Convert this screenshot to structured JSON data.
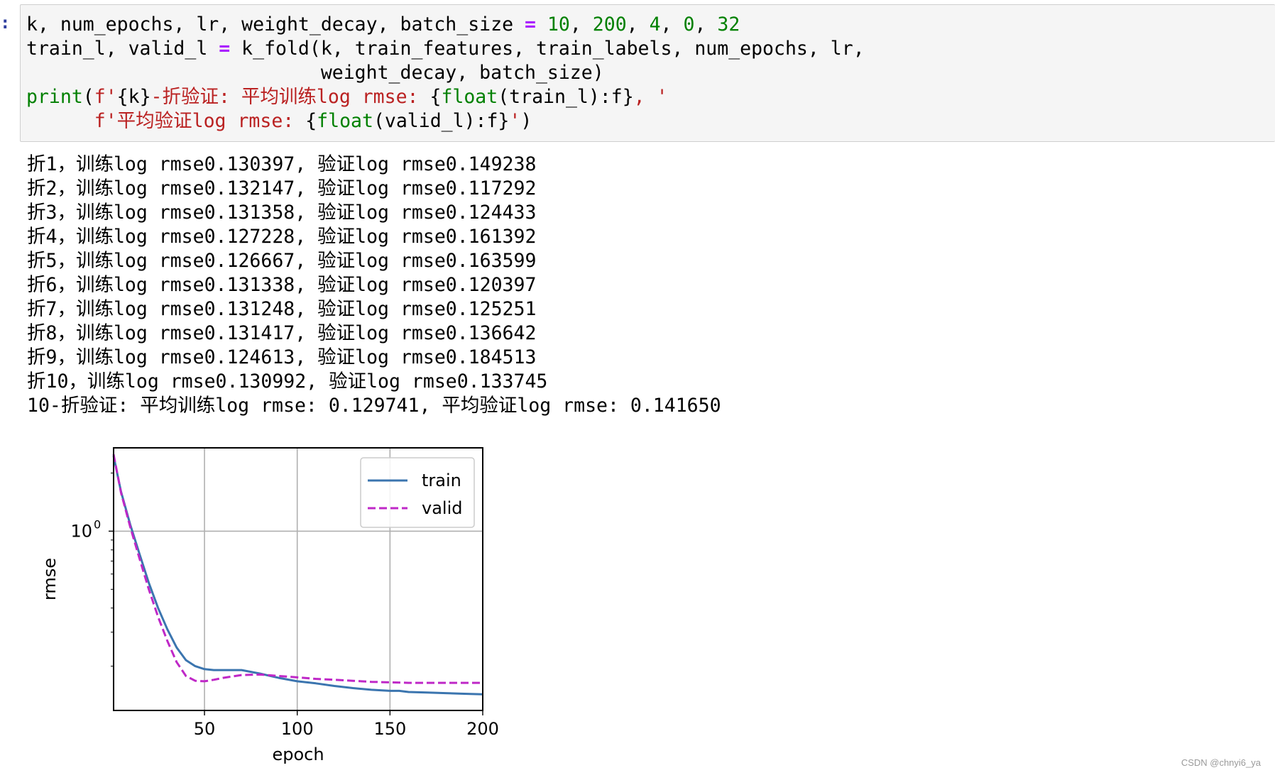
{
  "cell": {
    "prompt": ":",
    "code": [
      [
        {
          "t": "k, num_epochs, lr, weight_decay, batch_size ",
          "c": ""
        },
        {
          "t": "=",
          "c": "op"
        },
        {
          "t": " ",
          "c": ""
        },
        {
          "t": "10",
          "c": "num"
        },
        {
          "t": ", ",
          "c": ""
        },
        {
          "t": "200",
          "c": "num"
        },
        {
          "t": ", ",
          "c": ""
        },
        {
          "t": "4",
          "c": "num"
        },
        {
          "t": ", ",
          "c": ""
        },
        {
          "t": "0",
          "c": "num"
        },
        {
          "t": ", ",
          "c": ""
        },
        {
          "t": "32",
          "c": "num"
        }
      ],
      [
        {
          "t": "train_l, valid_l ",
          "c": ""
        },
        {
          "t": "=",
          "c": "op"
        },
        {
          "t": " k_fold(k, train_features, train_labels, num_epochs, lr,",
          "c": ""
        }
      ],
      [
        {
          "t": "                          weight_decay, batch_size)",
          "c": ""
        }
      ],
      [
        {
          "t": "print",
          "c": "kw"
        },
        {
          "t": "(",
          "c": ""
        },
        {
          "t": "f'",
          "c": "str"
        },
        {
          "t": "{k}",
          "c": ""
        },
        {
          "t": "-折验证: 平均训练log rmse: ",
          "c": "str"
        },
        {
          "t": "{",
          "c": ""
        },
        {
          "t": "float",
          "c": "kw"
        },
        {
          "t": "(train_l):f}",
          "c": ""
        },
        {
          "t": ", '",
          "c": "str"
        }
      ],
      [
        {
          "t": "      ",
          "c": ""
        },
        {
          "t": "f'平均验证log rmse: ",
          "c": "str"
        },
        {
          "t": "{",
          "c": ""
        },
        {
          "t": "float",
          "c": "kw"
        },
        {
          "t": "(valid_l):f}",
          "c": ""
        },
        {
          "t": "'",
          "c": "str"
        },
        {
          "t": ")",
          "c": ""
        }
      ]
    ],
    "output": [
      "折1，训练log rmse0.130397, 验证log rmse0.149238",
      "折2，训练log rmse0.132147, 验证log rmse0.117292",
      "折3，训练log rmse0.131358, 验证log rmse0.124433",
      "折4，训练log rmse0.127228, 验证log rmse0.161392",
      "折5，训练log rmse0.126667, 验证log rmse0.163599",
      "折6，训练log rmse0.131338, 验证log rmse0.120397",
      "折7，训练log rmse0.131248, 验证log rmse0.125251",
      "折8，训练log rmse0.131417, 验证log rmse0.136642",
      "折9，训练log rmse0.124613, 验证log rmse0.184513",
      "折10，训练log rmse0.130992, 验证log rmse0.133745",
      "10-折验证: 平均训练log rmse: 0.129741, 平均验证log rmse: 0.141650"
    ]
  },
  "chart_data": {
    "type": "line",
    "xlabel": "epoch",
    "ylabel": "rmse",
    "xlim": [
      1,
      200
    ],
    "ylim": [
      0.118,
      2.7
    ],
    "yscale": "log",
    "xticks": [
      "50",
      "100",
      "150",
      "200"
    ],
    "yticks": [
      {
        "base": "10",
        "exp": "0",
        "value": 1
      }
    ],
    "grid": true,
    "legend": "top-right",
    "series": [
      {
        "name": "train",
        "color": "#3b75af",
        "dash": "solid",
        "x": [
          1,
          5,
          10,
          15,
          20,
          25,
          30,
          35,
          40,
          45,
          50,
          55,
          60,
          70,
          80,
          90,
          100,
          110,
          120,
          130,
          140,
          150,
          155,
          160,
          170,
          180,
          190,
          200
        ],
        "y": [
          2.45,
          1.6,
          1.08,
          0.76,
          0.54,
          0.4,
          0.31,
          0.25,
          0.215,
          0.2,
          0.193,
          0.191,
          0.191,
          0.191,
          0.183,
          0.174,
          0.167,
          0.163,
          0.158,
          0.154,
          0.151,
          0.149,
          0.149,
          0.147,
          0.146,
          0.145,
          0.144,
          0.143
        ]
      },
      {
        "name": "valid",
        "color": "#bf28c7",
        "dash": "dashed",
        "x": [
          1,
          5,
          10,
          15,
          20,
          25,
          30,
          35,
          40,
          45,
          50,
          55,
          60,
          70,
          80,
          90,
          100,
          110,
          120,
          130,
          140,
          150,
          160,
          170,
          180,
          190,
          200
        ],
        "y": [
          2.5,
          1.58,
          1.05,
          0.72,
          0.5,
          0.36,
          0.27,
          0.21,
          0.178,
          0.168,
          0.167,
          0.17,
          0.174,
          0.18,
          0.181,
          0.178,
          0.175,
          0.172,
          0.17,
          0.168,
          0.166,
          0.165,
          0.164,
          0.164,
          0.164,
          0.164,
          0.164
        ]
      }
    ]
  },
  "watermark": "CSDN @chnyi6_ya"
}
